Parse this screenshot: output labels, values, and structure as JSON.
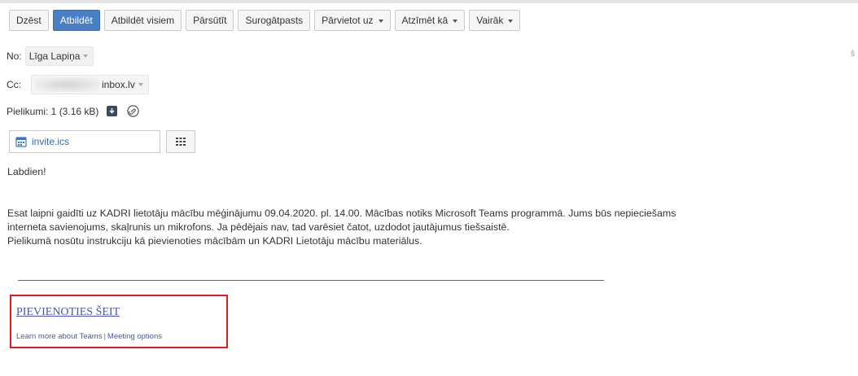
{
  "toolbar": {
    "buttons": [
      {
        "label": "Dzēst",
        "primary": false,
        "dropdown": false
      },
      {
        "label": "Atbildēt",
        "primary": true,
        "dropdown": false
      },
      {
        "label": "Atbildēt visiem",
        "primary": false,
        "dropdown": false
      },
      {
        "label": "Pārsūtīt",
        "primary": false,
        "dropdown": false
      },
      {
        "label": "Surogātpasts",
        "primary": false,
        "dropdown": false
      },
      {
        "label": "Pārvietot uz",
        "primary": false,
        "dropdown": true
      },
      {
        "label": "Atzīmēt kā",
        "primary": false,
        "dropdown": true
      },
      {
        "label": "Vairāk",
        "primary": false,
        "dropdown": true
      }
    ]
  },
  "header": {
    "from_label": "No:",
    "from_value": "Līga Lapiņa",
    "cc_label": "Cc:",
    "cc_value": "inbox.lv",
    "attachments_label": "Pielikumi: 1 (3.16 kB)",
    "edge_char": "š"
  },
  "attachment": {
    "filename": "invite.ics",
    "icon": "calendar-icon"
  },
  "body": {
    "greeting": "Labdien!",
    "line1": "Esat laipni gaidīti uz KADRI lietotāju mācību mēģinājumu 09.04.2020. pl. 14.00. Mācības notiks Microsoft Teams programmā. Jums būs nepieciešams",
    "line2": "interneta savienojums, skaļrunis un mikrofons. Ja pēdējais nav, tad varēsiet čatot, uzdodot jautājumus tiešsaistē.",
    "line3": "Pielikumā nosūtu instrukciju kā pievienoties mācībām un KADRI Lietotāju mācību materiālus."
  },
  "teams": {
    "join_label": "PIEVIENOTIES ŠEIT",
    "learn_more": "Learn more about Teams",
    "separator": "|",
    "meeting_options": "Meeting options"
  },
  "colors": {
    "primary_button": "#4a7fc6",
    "link": "#4b57a8",
    "highlight_box": "#e01e1e"
  }
}
